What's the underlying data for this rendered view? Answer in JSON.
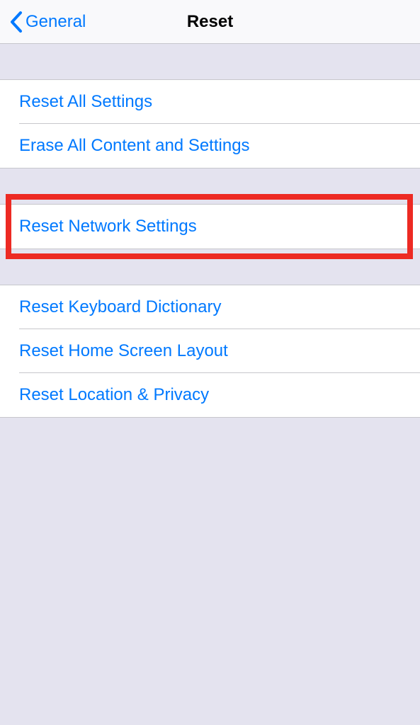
{
  "nav": {
    "back_label": "General",
    "title": "Reset"
  },
  "groups": [
    {
      "items": [
        {
          "label": "Reset All Settings"
        },
        {
          "label": "Erase All Content and Settings"
        }
      ]
    },
    {
      "items": [
        {
          "label": "Reset Network Settings"
        }
      ],
      "highlighted": true
    },
    {
      "items": [
        {
          "label": "Reset Keyboard Dictionary"
        },
        {
          "label": "Reset Home Screen Layout"
        },
        {
          "label": "Reset Location & Privacy"
        }
      ]
    }
  ],
  "colors": {
    "link": "#0079ff",
    "background": "#e4e3ef",
    "highlight": "#ed2a23"
  }
}
